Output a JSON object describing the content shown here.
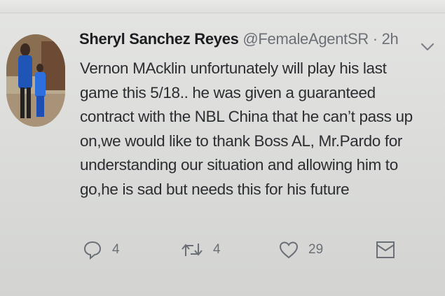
{
  "tweet": {
    "display_name": "Sheryl Sanchez Reyes",
    "handle": "@FemaleAgentSR",
    "separator": "·",
    "time": "2h",
    "text": "Vernon MAcklin unfortunately will play his last\ngame this 5/18.. he was given a guaranteed\ncontract with the NBL China that he can’t pass up\non,we would like to thank Boss AL, Mr.Pardo for\nunderstanding our situation and allowing him to\ngo,he is sad but needs this for his future"
  },
  "actions": {
    "reply_count": "4",
    "retweet_count": "4",
    "like_count": "29"
  },
  "icons": {
    "menu": "chevron-down-icon",
    "reply": "reply-icon",
    "retweet": "retweet-icon",
    "like": "heart-icon",
    "dm": "envelope-icon"
  },
  "colors": {
    "background": "#dcdddb",
    "text": "#2b2d31",
    "muted": "#6b7076"
  }
}
